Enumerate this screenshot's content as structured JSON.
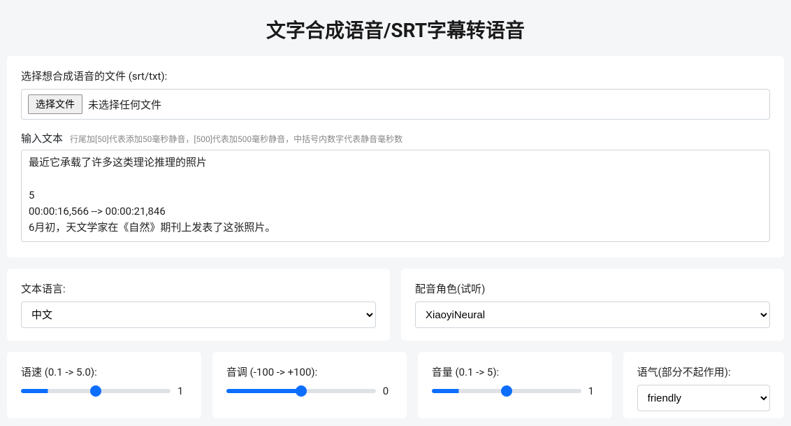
{
  "title": "文字合成语音/SRT字幕转语音",
  "filePicker": {
    "label": "选择想合成语音的文件 (srt/txt):",
    "buttonLabel": "选择文件",
    "statusText": "未选择任何文件"
  },
  "textarea": {
    "label": "输入文本",
    "hint": "行尾加[50]代表添加50毫秒静音，[500]代表加500毫秒静音，中括号内数字代表静音毫秒数",
    "value": "最近它承载了许多这类理论推理的照片\n\n5\n00:00:16,566 --> 00:00:21,846\n6月初，天文学家在《自然》期刊上发表了这张照片。"
  },
  "language": {
    "label": "文本语言:",
    "selected": "中文"
  },
  "voice": {
    "label": "配音角色(试听)",
    "selected": "XiaoyiNeural"
  },
  "sliders": {
    "speed": {
      "label": "语速 (0.1 -> 5.0):",
      "value": "1",
      "pct": "18%"
    },
    "pitch": {
      "label": "音调 (-100 -> +100):",
      "value": "0",
      "pct": "50%"
    },
    "volume": {
      "label": "音量 (0.1 -> 5):",
      "value": "1",
      "pct": "18%"
    }
  },
  "tone": {
    "label": "语气(部分不起作用):",
    "selected": "friendly"
  }
}
